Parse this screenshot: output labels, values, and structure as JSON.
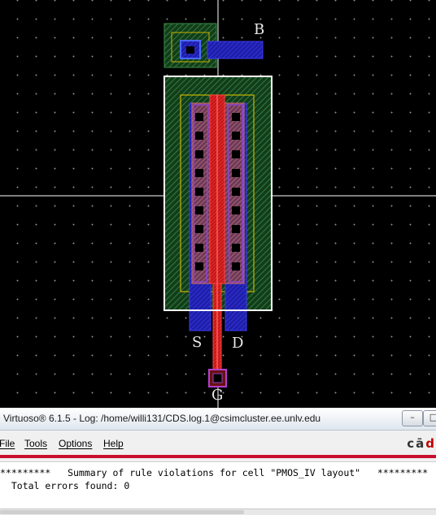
{
  "layout_view": {
    "pins": {
      "bulk": "B",
      "source": "S",
      "drain": "D",
      "gate": "G"
    },
    "colors": {
      "background": "#000000",
      "grid_dots": "#8a8a8a",
      "nwell": "#1f5a2a",
      "pselect": "#c8b400",
      "active": "#b25c5c",
      "metal1": "#2b2bd6",
      "poly": "#e02020",
      "contact": "#000000",
      "highlight_box": "#ffffff",
      "crosshair": "#ffffff"
    }
  },
  "log_window": {
    "title": "Virtuoso® 6.1.5 - Log: /home/willi131/CDS.log.1@csimcluster.ee.unlv.edu",
    "buttons": {
      "minimize": "–",
      "maximize": "□"
    },
    "menu": [
      {
        "label": "File"
      },
      {
        "label": "Tools"
      },
      {
        "label": "Options"
      },
      {
        "label": "Help"
      }
    ],
    "brand": {
      "main": "cā",
      "accent": "d"
    },
    "console_lines": [
      "*********   Summary of rule violations for cell \"PMOS_IV layout\"   *********",
      "  Total errors found: 0"
    ]
  }
}
